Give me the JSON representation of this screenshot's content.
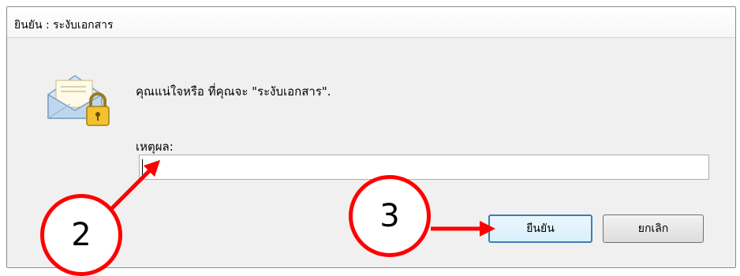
{
  "dialog": {
    "title": "ยินยัน : ระงับเอกสาร",
    "icon": "envelope-lock-icon",
    "question": "คุณแน่ใจหรือ ที่คุณจะ \"ระงับเอกสาร\".",
    "reason_label": "เหตุผล:",
    "reason_value": "",
    "reason_placeholder": ""
  },
  "buttons": {
    "confirm_label": "ยืนยัน",
    "cancel_label": "ยกเลิก"
  },
  "annotations": {
    "step_2": "2",
    "step_3": "3",
    "color": "#ff0000"
  }
}
